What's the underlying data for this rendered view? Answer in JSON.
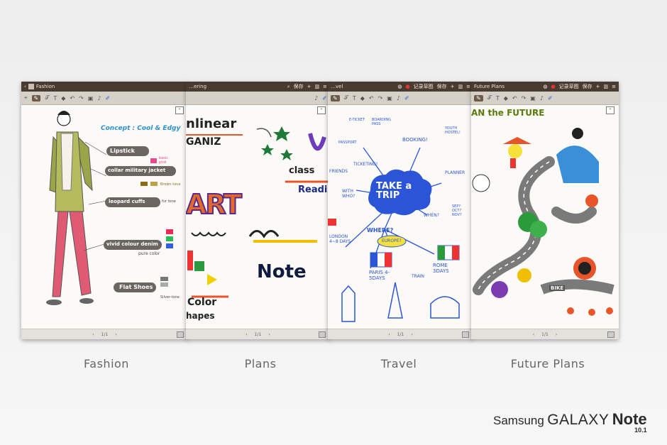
{
  "panels": [
    {
      "title": "Fashion",
      "caption": "Fashion",
      "pager": "1/1",
      "notes": {
        "concept": "Concept : Cool & Edgy",
        "items": [
          "Lipstick",
          "collar military jacket",
          "leopard cuffs",
          "vivid colour denim",
          "Flat Shoes"
        ],
        "side": [
          "basic pink",
          "Brown tone",
          "fur tone",
          "pure color",
          "Silver-tone"
        ]
      }
    },
    {
      "title": "…ering",
      "caption": "Plans",
      "pager": "1/1",
      "notes": {
        "top": "nlinear",
        "top2": "GANIZ",
        "big": "ART",
        "mid": "class",
        "mid2": "Readi",
        "note": "Note",
        "bottom": "Color",
        "bottom2": "hapes"
      }
    },
    {
      "title": "…vel",
      "caption": "Travel",
      "pager": "1/1",
      "notes": {
        "center": "TAKE a TRIP",
        "words": [
          "E-TICKET",
          "BOARDING PASS",
          "BOOKING!",
          "YOUTH HOSTEL!",
          "PASSPORT",
          "TICKETING!",
          "FRIENDS",
          "PLANNER",
          "WITH WHO?",
          "WHEN?",
          "SEP? OCT? NOV?",
          "WHERE?",
          "EUROPE?",
          "LONDON 4~8 DAYS",
          "PARIS 4-5DAYS",
          "ROME 3DAYS",
          "TRAIN"
        ]
      }
    },
    {
      "title": "Future Plans",
      "caption": "Future Plans",
      "pager": "1/1",
      "notes": {
        "header": "AN the FUTURE",
        "bike": "BIKE"
      }
    }
  ],
  "toolbar": {
    "save": "保存",
    "record": "记录草图"
  },
  "brand": {
    "line1": "Samsung",
    "line2": "GALAXY",
    "line3": "Note",
    "sub": "10.1"
  },
  "colors": {
    "titlebar": "#4a3b30",
    "toolbar": "#d6d1c8",
    "travelBlue": "#2b55d6"
  }
}
